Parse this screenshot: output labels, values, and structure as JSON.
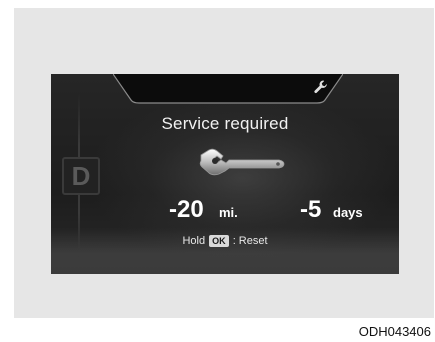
{
  "cluster": {
    "gear": "D",
    "title": "Service required",
    "distance_value": "-20",
    "distance_unit": "mi.",
    "days_value": "-5",
    "days_unit": "days",
    "hint_prefix": "Hold",
    "hint_key": "OK",
    "hint_suffix": ": Reset",
    "icons": {
      "top": "wrench-icon",
      "center": "wrench-icon"
    }
  },
  "caption": "ODH043406",
  "colors": {
    "display_bg": "#1c1c1c",
    "text": "#ffffff",
    "frame_bg": "#e6e6e6"
  }
}
